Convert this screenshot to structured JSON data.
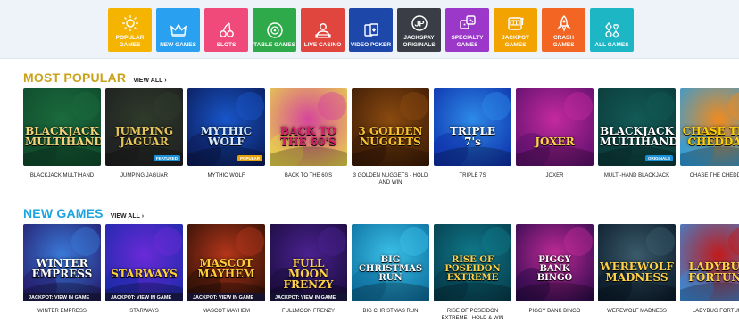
{
  "categories": [
    {
      "label": "Popular Games",
      "icon": "sun-icon",
      "color": "#f4b400"
    },
    {
      "label": "New Games",
      "icon": "crown-icon",
      "color": "#2aa1f0"
    },
    {
      "label": "Slots",
      "icon": "cherries-icon",
      "color": "#ef4a7a"
    },
    {
      "label": "Table Games",
      "icon": "roulette-icon",
      "color": "#2eaa4a"
    },
    {
      "label": "Live Casino",
      "icon": "dealer-icon",
      "color": "#e0463e"
    },
    {
      "label": "Video Poker",
      "icon": "cards-icon",
      "color": "#1d47a8"
    },
    {
      "label": "Jackspay Originals",
      "icon": "jackspay-icon",
      "color": "#3a3d46"
    },
    {
      "label": "Specialty Games",
      "icon": "dice-icon",
      "color": "#9b38c9"
    },
    {
      "label": "Jackpot Games",
      "icon": "slot-machine-icon",
      "color": "#f2a300"
    },
    {
      "label": "Crash Games",
      "icon": "rocket-icon",
      "color": "#f26522"
    },
    {
      "label": "All Games",
      "icon": "suits-icon",
      "color": "#1cb6c5"
    }
  ],
  "most_popular": {
    "title": "MOST POPULAR",
    "title_color": "#c9a21a",
    "view_all": "VIEW ALL",
    "games": [
      {
        "name": "Blackjack Multihand",
        "art": "BLACKJACK MULTIHAND",
        "bg1": "#0f4a2c",
        "bg2": "#1b6b3d",
        "fg": "#f2d27a"
      },
      {
        "name": "Jumping Jaguar",
        "art": "JUMPING JAGUAR",
        "bg1": "#1f1f22",
        "bg2": "#2f3b2a",
        "fg": "#e4c25a",
        "badge": "Featured",
        "badge_color": "#1a8fd8"
      },
      {
        "name": "Mythic Wolf",
        "art": "MYTHIC WOLF",
        "bg1": "#0b1a55",
        "bg2": "#1856c9",
        "fg": "#d9ecff",
        "badge": "Popular",
        "badge_color": "#e5a20a"
      },
      {
        "name": "Back to the 60's",
        "art": "BACK TO THE 60'S",
        "bg1": "#e8d64a",
        "bg2": "#d6459b",
        "fg": "#d61d6a"
      },
      {
        "name": "3 Golden Nuggets - Hold and Win",
        "art": "3 GOLDEN NUGGETS",
        "bg1": "#3a1a06",
        "bg2": "#8a4a10",
        "fg": "#f6c12e"
      },
      {
        "name": "Triple 7s",
        "art": "TRIPLE 7's",
        "bg1": "#0d2ea8",
        "bg2": "#2d8ae8",
        "fg": "#ffffff"
      },
      {
        "name": "Joxer",
        "art": "JOXER",
        "bg1": "#5a0f6b",
        "bg2": "#c42aa0",
        "fg": "#ffd24a"
      },
      {
        "name": "Multi-hand Blackjack",
        "art": "BLACKJACK MULTIHAND",
        "bg1": "#0c3a3a",
        "bg2": "#125a55",
        "fg": "#ffffff",
        "badge": "Originals",
        "badge_color": "#1a8fd8"
      },
      {
        "name": "Chase the Cheddar",
        "art": "CHASE THE CHEDDAR",
        "bg1": "#2a9de0",
        "bg2": "#f08a1e",
        "fg": "#ffd000"
      }
    ]
  },
  "new_games": {
    "title": "NEW GAMES",
    "title_color": "#1ca4e0",
    "view_all": "VIEW ALL",
    "jackpot_label": "JACKPOT: VIEW IN GAME",
    "games": [
      {
        "name": "Winter Empress",
        "art": "WINTER EMPRESS",
        "bg1": "#241a6a",
        "bg2": "#3a7ad8",
        "fg": "#ffffff",
        "jackpot": true
      },
      {
        "name": "Starways",
        "art": "STARWAYS",
        "bg1": "#1a2aa8",
        "bg2": "#6a2ad8",
        "fg": "#ffd13a",
        "jackpot": true
      },
      {
        "name": "Mascot Mayhem",
        "art": "MASCOT MAYHEM",
        "bg1": "#2a0f06",
        "bg2": "#b4361a",
        "fg": "#ffcf3a",
        "jackpot": true
      },
      {
        "name": "Fullmoon Frenzy",
        "art": "FULL MOON FRENZY",
        "bg1": "#190b3a",
        "bg2": "#4a2290",
        "fg": "#ffd24a",
        "jackpot": true
      },
      {
        "name": "Big Christmas Run",
        "art": "BIG CHRISTMAS RUN",
        "bg1": "#0b6a9a",
        "bg2": "#3ac1e8",
        "fg": "#ffffff"
      },
      {
        "name": "Rise of Poseidon Extreme - Hold & Win",
        "art": "RISE OF POSEIDON EXTREME",
        "bg1": "#063a4a",
        "bg2": "#0f7a8a",
        "fg": "#ffd24a"
      },
      {
        "name": "Piggy Bank Bingo",
        "art": "PIGGY BANK BINGO",
        "bg1": "#2a0a4a",
        "bg2": "#c02a98",
        "fg": "#ffffff"
      },
      {
        "name": "Werewolf Madness",
        "art": "WEREWOLF MADNESS",
        "bg1": "#0a1a2a",
        "bg2": "#3a5a6a",
        "fg": "#ffd24a"
      },
      {
        "name": "Ladybug Fortune",
        "art": "LADYBUG FORTUNE",
        "bg1": "#3a8ad8",
        "bg2": "#c21a1a",
        "fg": "#ffd24a"
      }
    ]
  }
}
